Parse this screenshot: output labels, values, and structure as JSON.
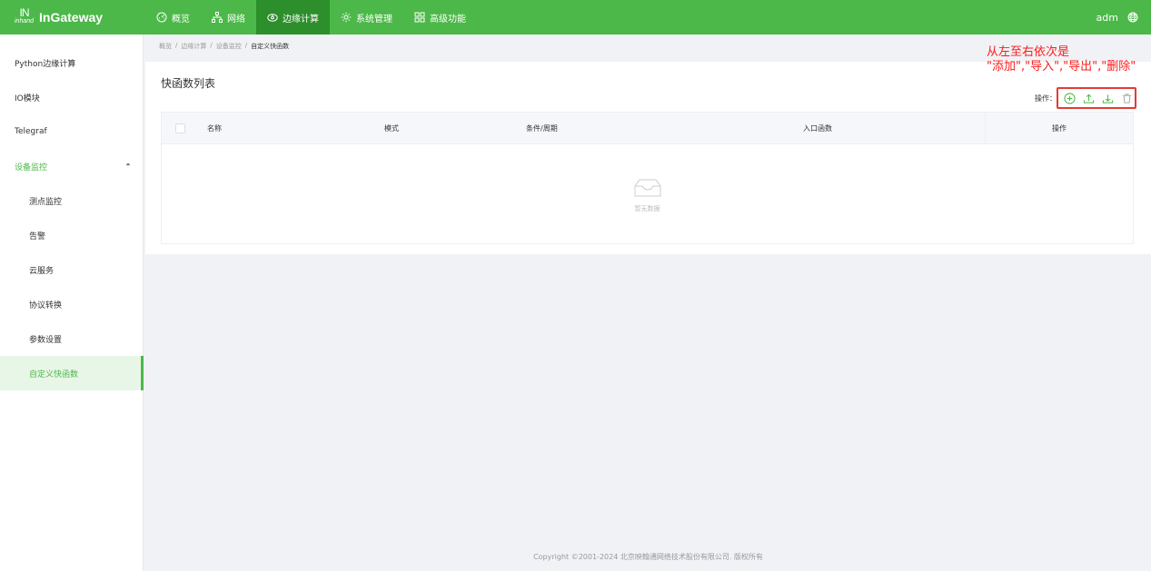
{
  "brand": {
    "mark_top": "IN",
    "mark_bottom": "inhand",
    "name": "InGateway"
  },
  "nav": [
    {
      "label": "概览",
      "icon": "dashboard-icon"
    },
    {
      "label": "网络",
      "icon": "network-icon"
    },
    {
      "label": "边缘计算",
      "icon": "edge-computing-icon"
    },
    {
      "label": "系统管理",
      "icon": "gear-icon"
    },
    {
      "label": "高级功能",
      "icon": "grid-icon"
    }
  ],
  "user": {
    "name": "adm",
    "icon": "globe-icon"
  },
  "sidebar": {
    "items": [
      {
        "label": "Python边缘计算"
      },
      {
        "label": "IO模块"
      },
      {
        "label": "Telegraf"
      },
      {
        "label": "设备监控"
      },
      {
        "label": "测点监控"
      },
      {
        "label": "告警"
      },
      {
        "label": "云服务"
      },
      {
        "label": "协议转换"
      },
      {
        "label": "参数设置"
      },
      {
        "label": "自定义快函数"
      }
    ]
  },
  "breadcrumb": [
    "概览",
    "边缘计算",
    "设备监控",
    "自定义快函数"
  ],
  "breadcrumb_sep": "/",
  "panel": {
    "title": "快函数列表",
    "ops_label": "操作：",
    "ops_icons": [
      "add-icon",
      "import-icon",
      "export-icon",
      "delete-icon"
    ]
  },
  "annotation": {
    "line1": "从左至右依次是",
    "line2": "\"添加\",\"导入\",\"导出\",\"删除\"",
    "color": "#ff1a1a"
  },
  "table": {
    "columns": [
      "名称",
      "模式",
      "条件/周期",
      "入口函数",
      "操作"
    ],
    "empty_text": "暂无数据"
  },
  "footer": "Copyright ©2001-2024 北京映翰通网络技术股份有限公司. 版权所有",
  "colors": {
    "primary": "#4cb849",
    "nav_active": "#2d8f2b",
    "highlight": "#e53935"
  }
}
